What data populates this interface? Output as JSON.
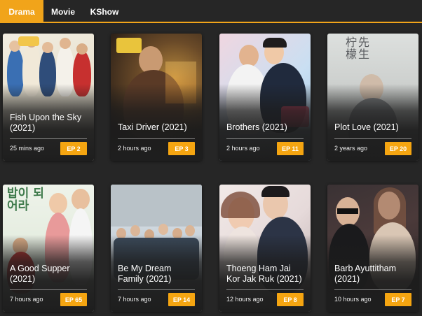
{
  "tabs": [
    {
      "label": "Drama",
      "active": true
    },
    {
      "label": "Movie",
      "active": false
    },
    {
      "label": "KShow",
      "active": false
    }
  ],
  "accent_color": "#f1a41a",
  "cards": [
    {
      "title": "Fish Upon the Sky (2021)",
      "time": "25 mins ago",
      "episode": "EP 2"
    },
    {
      "title": "Taxi Driver (2021)",
      "time": "2 hours ago",
      "episode": "EP 3"
    },
    {
      "title": "Brothers (2021)",
      "time": "2 hours ago",
      "episode": "EP 11"
    },
    {
      "title": "Plot Love (2021)",
      "time": "2 years ago",
      "episode": "EP 20"
    },
    {
      "title": "A Good Supper (2021)",
      "time": "7 hours ago",
      "episode": "EP 65"
    },
    {
      "title": "Be My Dream Family (2021)",
      "time": "7 hours ago",
      "episode": "EP 14"
    },
    {
      "title": "Thoeng Ham Jai Kor Jak Ruk (2021)",
      "time": "12 hours ago",
      "episode": "EP 8"
    },
    {
      "title": "Barb Ayuttitham (2021)",
      "time": "10 hours ago",
      "episode": "EP 7"
    }
  ],
  "poster_text": {
    "plot_love": "柠檬先生",
    "good_supper": "밥이 되어라"
  }
}
